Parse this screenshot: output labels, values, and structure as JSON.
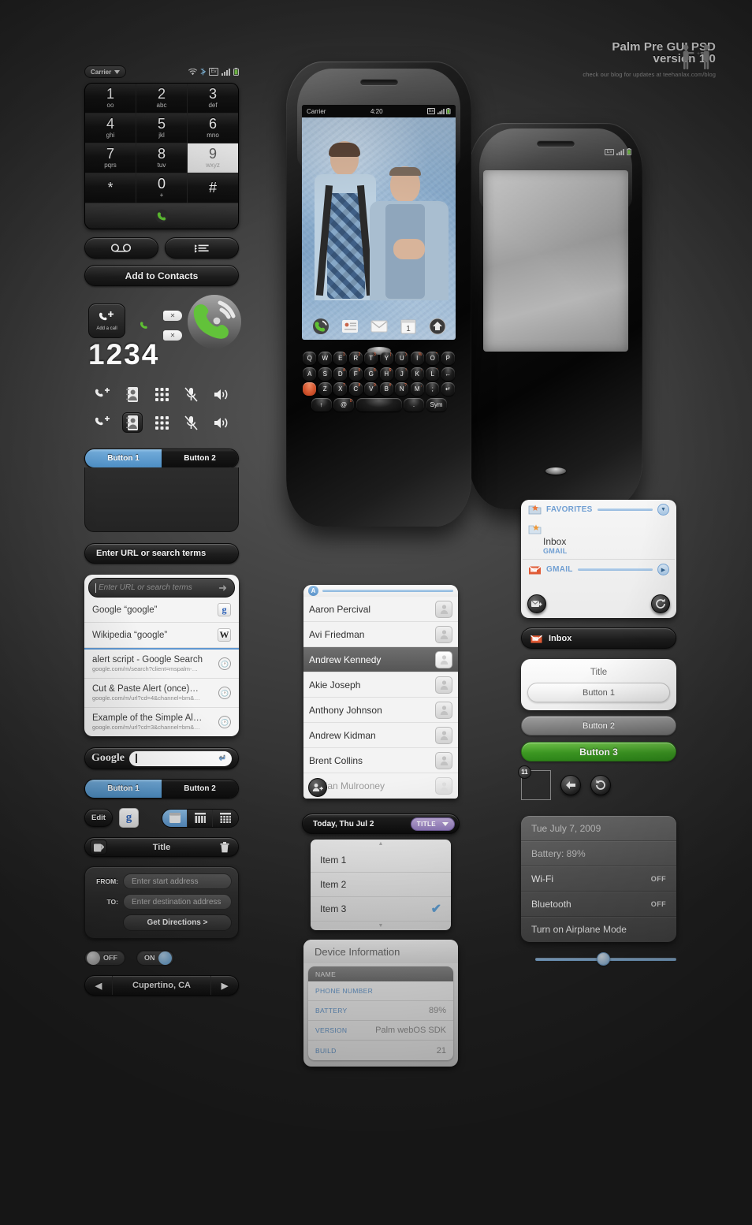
{
  "header": {
    "title_line1": "Palm Pre GUI PSD",
    "title_line2": "version 1.0",
    "subtitle": "check our blog for updates at teehanlax.com/blog"
  },
  "phone_app": {
    "carrier": "Carrier",
    "status_icons": [
      "wifi-icon",
      "bluetooth-icon",
      "ev-icon",
      "signal-icon",
      "battery-icon"
    ],
    "dialpad": [
      [
        {
          "num": "1",
          "sub": "oo",
          "active": false
        },
        {
          "num": "2",
          "sub": "abc",
          "active": false
        },
        {
          "num": "3",
          "sub": "def",
          "active": false
        }
      ],
      [
        {
          "num": "4",
          "sub": "ghi",
          "active": false
        },
        {
          "num": "5",
          "sub": "jkl",
          "active": false
        },
        {
          "num": "6",
          "sub": "mno",
          "active": false
        }
      ],
      [
        {
          "num": "7",
          "sub": "pqrs",
          "active": false
        },
        {
          "num": "8",
          "sub": "tuv",
          "active": false
        },
        {
          "num": "9",
          "sub": "wxyz",
          "active": true
        }
      ],
      [
        {
          "num": "*",
          "sub": "",
          "active": false
        },
        {
          "num": "0",
          "sub": "+",
          "active": false
        },
        {
          "num": "#",
          "sub": "",
          "active": false
        }
      ]
    ],
    "voicemail_label": "voicemail-icon",
    "calllist_label": "call-list-icon",
    "add_to_contacts": "Add to Contacts",
    "add_a_call": "Add a call",
    "dialed_digits": "1234",
    "icon_rows": [
      [
        "add-call-icon",
        "contacts-icon",
        "dialpad-icon",
        "mute-icon",
        "speaker-icon"
      ],
      [
        "add-call-icon",
        "contacts-icon",
        "dialpad-icon",
        "mute-icon",
        "speaker-icon"
      ]
    ]
  },
  "tabs": {
    "tab1": "Button 1",
    "tab2": "Button 2"
  },
  "url_bar": {
    "label": "Enter URL or search terms"
  },
  "search_card": {
    "placeholder": "Enter URL or search terms",
    "results": [
      {
        "title": "Google “google”",
        "sub": "",
        "icon": "google-icon"
      },
      {
        "title": "Wikipedia “google”",
        "sub": "",
        "icon": "wikipedia-icon"
      },
      {
        "title": "alert script - Google Search",
        "sub": "google.com/m/search?client=mspalm-…",
        "icon": "history-icon"
      },
      {
        "title": "Cut & Paste Alert (once)…",
        "sub": "google.com/m/url?cd=4&channel=bm&…",
        "icon": "history-icon"
      },
      {
        "title": "Example of the Simple Al…",
        "sub": "google.com/m/url?cd=3&channel=bm&…",
        "icon": "history-icon"
      }
    ]
  },
  "google_bar": {
    "logo": "Google"
  },
  "tabs2": {
    "tab1": "Button 1",
    "tab2": "Button 2"
  },
  "edit_row": {
    "edit": "Edit",
    "google_badge": "g",
    "views": [
      "single-view-icon",
      "column-view-icon",
      "grid-view-icon"
    ]
  },
  "title_bar": {
    "share": "share-icon",
    "title": "Title",
    "trash": "trash-icon"
  },
  "directions": {
    "from_label": "FROM:",
    "from_placeholder": "Enter start address",
    "to_label": "TO:",
    "to_placeholder": "Enter destination address",
    "submit": "Get Directions >"
  },
  "toggles": {
    "off": "OFF",
    "on": "ON"
  },
  "stepper": {
    "prev": "prev-icon",
    "value": "Cupertino, CA",
    "next": "next-icon"
  },
  "device_screen": {
    "carrier": "Carrier",
    "time": "4:20",
    "status_icons": [
      "ev-icon",
      "signal-icon",
      "battery-icon"
    ],
    "dock": [
      "phone-icon",
      "contacts-icon",
      "email-icon",
      "calendar-icon",
      "launcher-icon"
    ]
  },
  "keyboard": {
    "row1": [
      {
        "k": "Q",
        "s": ""
      },
      {
        "k": "W",
        "s": ""
      },
      {
        "k": "E",
        "s": "1"
      },
      {
        "k": "R",
        "s": "2"
      },
      {
        "k": "T",
        "s": "3"
      },
      {
        "k": "Y",
        "s": "("
      },
      {
        "k": "U",
        "s": ")"
      },
      {
        "k": "I",
        "s": "%"
      },
      {
        "k": "O",
        "s": "\""
      },
      {
        "k": "P",
        "s": ""
      }
    ],
    "row2": [
      {
        "k": "A",
        "s": ""
      },
      {
        "k": "S",
        "s": ""
      },
      {
        "k": "D",
        "s": "4"
      },
      {
        "k": "F",
        "s": "5"
      },
      {
        "k": "G",
        "s": "6"
      },
      {
        "k": "H",
        "s": "$"
      },
      {
        "k": "J",
        "s": "!"
      },
      {
        "k": "K",
        "s": ":"
      },
      {
        "k": "L",
        "s": "’"
      },
      {
        "k": "←",
        "s": ""
      }
    ],
    "row3": [
      {
        "k": "",
        "s": ""
      },
      {
        "k": "Z",
        "s": ""
      },
      {
        "k": "X",
        "s": "7"
      },
      {
        "k": "C",
        "s": "8"
      },
      {
        "k": "V",
        "s": "9"
      },
      {
        "k": "B",
        "s": "#"
      },
      {
        "k": "N",
        "s": "?"
      },
      {
        "k": "M",
        "s": ","
      },
      {
        "k": ";",
        "s": ""
      },
      {
        "k": "↵",
        "s": ""
      }
    ],
    "row4": [
      {
        "k": "↑",
        "s": ""
      },
      {
        "k": "@",
        "s": "0"
      },
      {
        "k": "",
        "s": ""
      },
      {
        "k": ".",
        "s": ""
      },
      {
        "k": "Sym",
        "s": ""
      }
    ]
  },
  "contacts": {
    "section": "A",
    "items": [
      {
        "name": "Aaron Percival",
        "state": "normal"
      },
      {
        "name": "Avi Friedman",
        "state": "normal"
      },
      {
        "name": "Andrew Kennedy",
        "state": "selected"
      },
      {
        "name": "Akie Joseph",
        "state": "normal"
      },
      {
        "name": "Anthony Johnson",
        "state": "normal"
      },
      {
        "name": "Andrew Kidman",
        "state": "normal"
      },
      {
        "name": "Brent Collins",
        "state": "normal"
      },
      {
        "name": "Ian Mulrooney",
        "state": "dim"
      }
    ],
    "fab": "add-contact-icon"
  },
  "today": {
    "title": "Today, Thu Jul 2",
    "chip": "TITLE",
    "items": [
      {
        "label": "Item 1",
        "checked": false
      },
      {
        "label": "Item 2",
        "checked": false
      },
      {
        "label": "Item 3",
        "checked": true
      }
    ]
  },
  "device_info": {
    "title": "Device Information",
    "name_header": "NAME",
    "rows": [
      {
        "key": "PHONE NUMBER",
        "value": ""
      },
      {
        "key": "BATTERY",
        "value": "89%"
      },
      {
        "key": "VERSION",
        "value": "Palm webOS SDK"
      },
      {
        "key": "BUILD",
        "value": "21"
      }
    ]
  },
  "mail": {
    "favorites": "FAVORITES",
    "inbox_title": "Inbox",
    "inbox_sub": "GMAIL",
    "gmail": "GMAIL",
    "compose": "compose-icon",
    "refresh": "refresh-icon",
    "inbox_button": "Inbox"
  },
  "button_panel": {
    "title": "Title",
    "button1": "Button 1",
    "button2": "Button 2",
    "button3": "Button 3",
    "card_count": "11",
    "back": "back-icon",
    "reload": "reload-icon"
  },
  "settings": {
    "rows": [
      {
        "key": "Tue July 7, 2009",
        "value": "",
        "muted": true
      },
      {
        "key": "Battery: 89%",
        "value": "",
        "muted": true
      },
      {
        "key": "Wi-Fi",
        "value": "OFF",
        "muted": false
      },
      {
        "key": "Bluetooth",
        "value": "OFF",
        "muted": false
      },
      {
        "key": "Turn on Airplane Mode",
        "value": "",
        "muted": false
      }
    ]
  },
  "colors": {
    "accent_blue": "#5790c6",
    "green": "#3e9b23",
    "purple": "#8e78b8",
    "link_blue": "#6c9fd4"
  }
}
